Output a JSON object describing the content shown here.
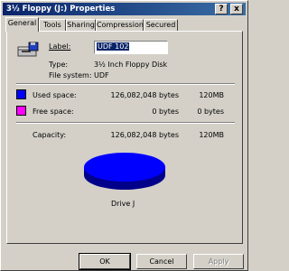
{
  "window": {
    "title": "3½ Floppy (J:) Properties"
  },
  "titlebar": {
    "help": "?",
    "close": "x"
  },
  "tabs": [
    {
      "label": "General",
      "active": true
    },
    {
      "label": "Tools",
      "active": false
    },
    {
      "label": "Sharing",
      "active": false
    },
    {
      "label": "Compression",
      "active": false
    },
    {
      "label": "Secured",
      "active": false
    }
  ],
  "general": {
    "label_caption": "Label:",
    "label_value": "UDF 102",
    "type_caption": "Type:",
    "type_value": "3½ Inch Floppy Disk",
    "fs_caption": "File system:",
    "fs_value": "UDF",
    "used_caption": "Used space:",
    "used_bytes": "126,082,048 bytes",
    "used_mb": "120MB",
    "free_caption": "Free space:",
    "free_bytes": "0 bytes",
    "free_mb": "0 bytes",
    "capacity_caption": "Capacity:",
    "capacity_bytes": "126,082,048 bytes",
    "capacity_mb": "120MB",
    "drive_caption": "Drive J"
  },
  "colors": {
    "used": "#0000ff",
    "free": "#ff00ff",
    "title_bar": "#0a246a"
  },
  "buttons": {
    "ok": "OK",
    "cancel": "Cancel",
    "apply": "Apply"
  }
}
